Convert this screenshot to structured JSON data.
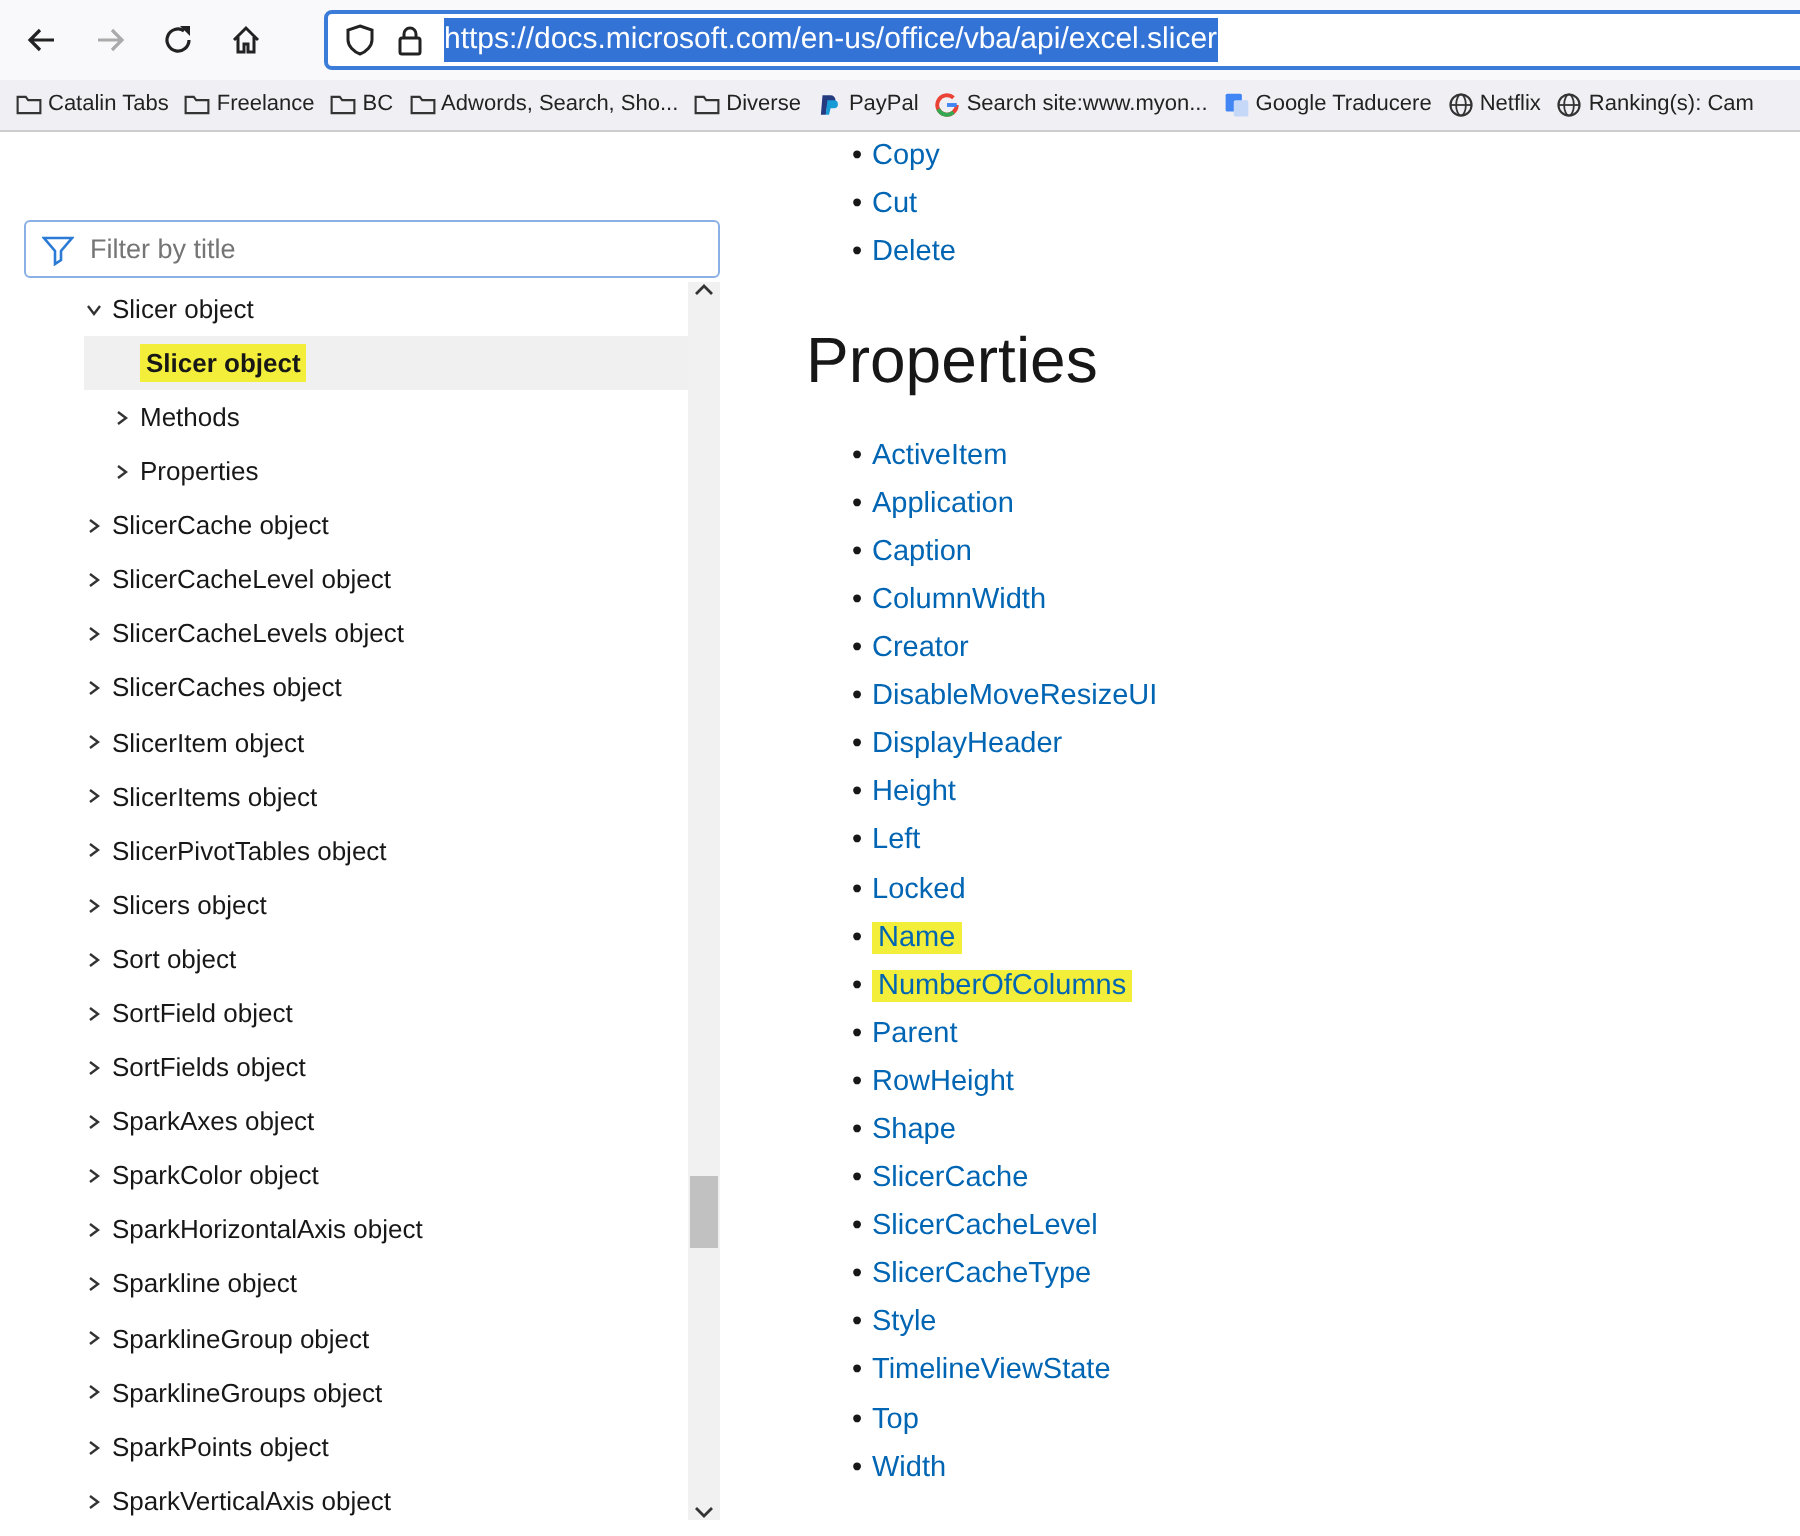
{
  "browser": {
    "back_disabled": false,
    "forward_disabled": true,
    "url": "https://docs.microsoft.com/en-us/office/vba/api/excel.slicer",
    "url_selected": true
  },
  "bookmarks": [
    {
      "label": "Catalin Tabs",
      "kind": "folder"
    },
    {
      "label": "Freelance",
      "kind": "folder"
    },
    {
      "label": "BC",
      "kind": "folder"
    },
    {
      "label": "Adwords, Search, Sho...",
      "kind": "folder"
    },
    {
      "label": "Diverse",
      "kind": "folder"
    },
    {
      "label": "PayPal",
      "kind": "paypal"
    },
    {
      "label": "Search site:www.myon...",
      "kind": "google"
    },
    {
      "label": "Google Traducere",
      "kind": "translate"
    },
    {
      "label": "Netflix",
      "kind": "globe"
    },
    {
      "label": "Ranking(s): Cam",
      "kind": "globe"
    }
  ],
  "sidebar": {
    "filter": {
      "placeholder": "Filter by title"
    },
    "tree": [
      {
        "label": "Slicer object",
        "kind": "section",
        "expanded": true,
        "selected": false,
        "highlighted": false,
        "children": [
          {
            "label": "Slicer object",
            "kind": "page",
            "selected": true,
            "highlighted": true
          },
          {
            "label": "Methods",
            "kind": "section",
            "expanded": false,
            "selected": false,
            "highlighted": false
          },
          {
            "label": "Properties",
            "kind": "section",
            "expanded": false,
            "selected": false,
            "highlighted": false
          }
        ]
      },
      {
        "label": "SlicerCache object",
        "kind": "section",
        "expanded": false,
        "selected": false,
        "highlighted": false
      },
      {
        "label": "SlicerCacheLevel object",
        "kind": "section",
        "expanded": false,
        "selected": false,
        "highlighted": false
      },
      {
        "label": "SlicerCacheLevels object",
        "kind": "section",
        "expanded": false,
        "selected": false,
        "highlighted": false
      },
      {
        "label": "SlicerCaches object",
        "kind": "section",
        "expanded": false,
        "selected": false,
        "highlighted": false
      },
      {
        "label": "SlicerItem object",
        "kind": "section",
        "expanded": false,
        "selected": false,
        "highlighted": false
      },
      {
        "label": "SlicerItems object",
        "kind": "section",
        "expanded": false,
        "selected": false,
        "highlighted": false
      },
      {
        "label": "SlicerPivotTables object",
        "kind": "section",
        "expanded": false,
        "selected": false,
        "highlighted": false
      },
      {
        "label": "Slicers object",
        "kind": "section",
        "expanded": false,
        "selected": false,
        "highlighted": false
      },
      {
        "label": "Sort object",
        "kind": "section",
        "expanded": false,
        "selected": false,
        "highlighted": false
      },
      {
        "label": "SortField object",
        "kind": "section",
        "expanded": false,
        "selected": false,
        "highlighted": false
      },
      {
        "label": "SortFields object",
        "kind": "section",
        "expanded": false,
        "selected": false,
        "highlighted": false
      },
      {
        "label": "SparkAxes object",
        "kind": "section",
        "expanded": false,
        "selected": false,
        "highlighted": false
      },
      {
        "label": "SparkColor object",
        "kind": "section",
        "expanded": false,
        "selected": false,
        "highlighted": false
      },
      {
        "label": "SparkHorizontalAxis object",
        "kind": "section",
        "expanded": false,
        "selected": false,
        "highlighted": false
      },
      {
        "label": "Sparkline object",
        "kind": "section",
        "expanded": false,
        "selected": false,
        "highlighted": false
      },
      {
        "label": "SparklineGroup object",
        "kind": "section",
        "expanded": false,
        "selected": false,
        "highlighted": false
      },
      {
        "label": "SparklineGroups object",
        "kind": "section",
        "expanded": false,
        "selected": false,
        "highlighted": false
      },
      {
        "label": "SparkPoints object",
        "kind": "section",
        "expanded": false,
        "selected": false,
        "highlighted": false
      },
      {
        "label": "SparkVerticalAxis object",
        "kind": "section",
        "expanded": false,
        "selected": false,
        "highlighted": false
      }
    ]
  },
  "content": {
    "bullet": "•",
    "methods": [
      {
        "label": "Copy",
        "highlighted": false
      },
      {
        "label": "Cut",
        "highlighted": false
      },
      {
        "label": "Delete",
        "highlighted": false
      }
    ],
    "heading": "Properties",
    "properties": [
      {
        "label": "ActiveItem",
        "highlighted": false
      },
      {
        "label": "Application",
        "highlighted": false
      },
      {
        "label": "Caption",
        "highlighted": false
      },
      {
        "label": "ColumnWidth",
        "highlighted": false
      },
      {
        "label": "Creator",
        "highlighted": false
      },
      {
        "label": "DisableMoveResizeUI",
        "highlighted": false
      },
      {
        "label": "DisplayHeader",
        "highlighted": false
      },
      {
        "label": "Height",
        "highlighted": false
      },
      {
        "label": "Left",
        "highlighted": false
      },
      {
        "label": "Locked",
        "highlighted": false
      },
      {
        "label": "Name",
        "highlighted": true
      },
      {
        "label": "NumberOfColumns",
        "highlighted": true
      },
      {
        "label": "Parent",
        "highlighted": false
      },
      {
        "label": "RowHeight",
        "highlighted": false
      },
      {
        "label": "Shape",
        "highlighted": false
      },
      {
        "label": "SlicerCache",
        "highlighted": false
      },
      {
        "label": "SlicerCacheLevel",
        "highlighted": false
      },
      {
        "label": "SlicerCacheType",
        "highlighted": false
      },
      {
        "label": "Style",
        "highlighted": false
      },
      {
        "label": "TimelineViewState",
        "highlighted": false
      },
      {
        "label": "Top",
        "highlighted": false
      },
      {
        "label": "Width",
        "highlighted": false
      }
    ]
  }
}
